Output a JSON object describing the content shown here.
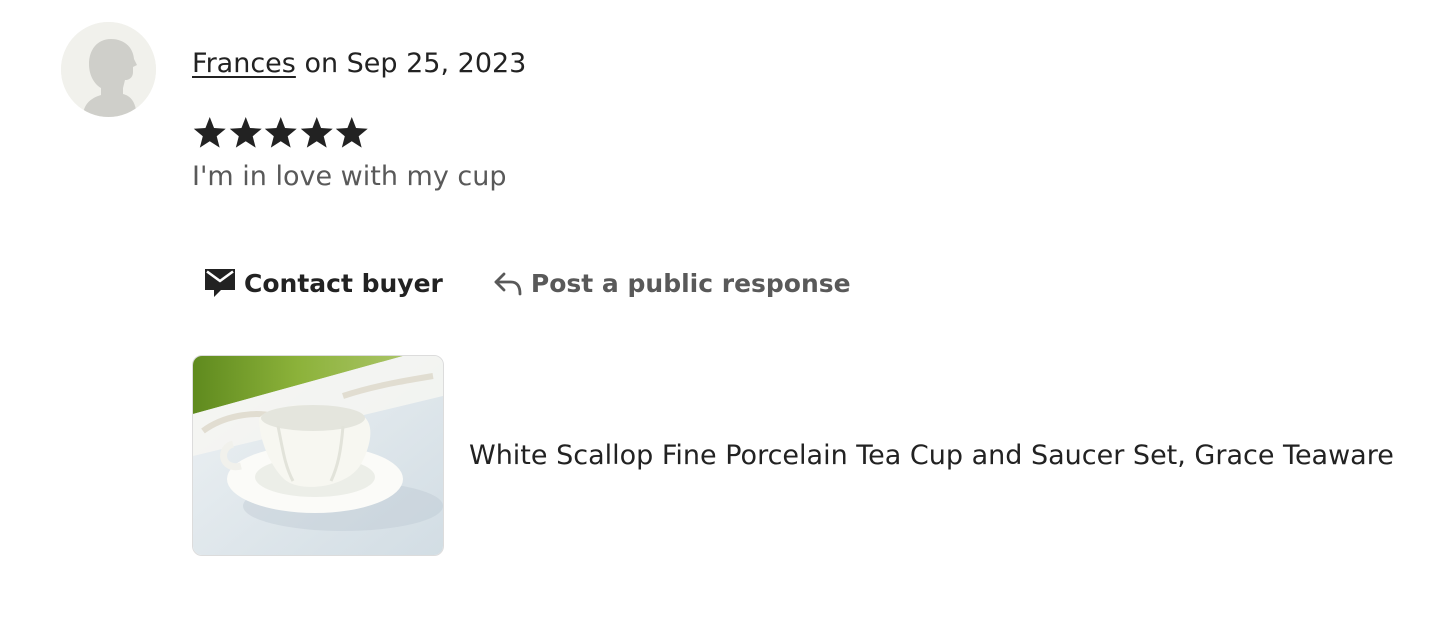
{
  "review": {
    "reviewer_name": "Frances",
    "date_text": " on Sep 25, 2023",
    "rating": 5,
    "rating_max": 5,
    "text": "I'm in love with my cup"
  },
  "actions": {
    "contact_label": "Contact buyer",
    "contact_icon": "envelope-icon",
    "respond_label": "Post a public response",
    "respond_icon": "reply-arrow-icon"
  },
  "product": {
    "title": "White Scallop Fine Porcelain Tea Cup and Saucer Set, Grace Teaware"
  },
  "colors": {
    "text_primary": "#222222",
    "text_secondary": "#595959",
    "star": "#222222",
    "avatar_bg": "#f1f1ec"
  }
}
